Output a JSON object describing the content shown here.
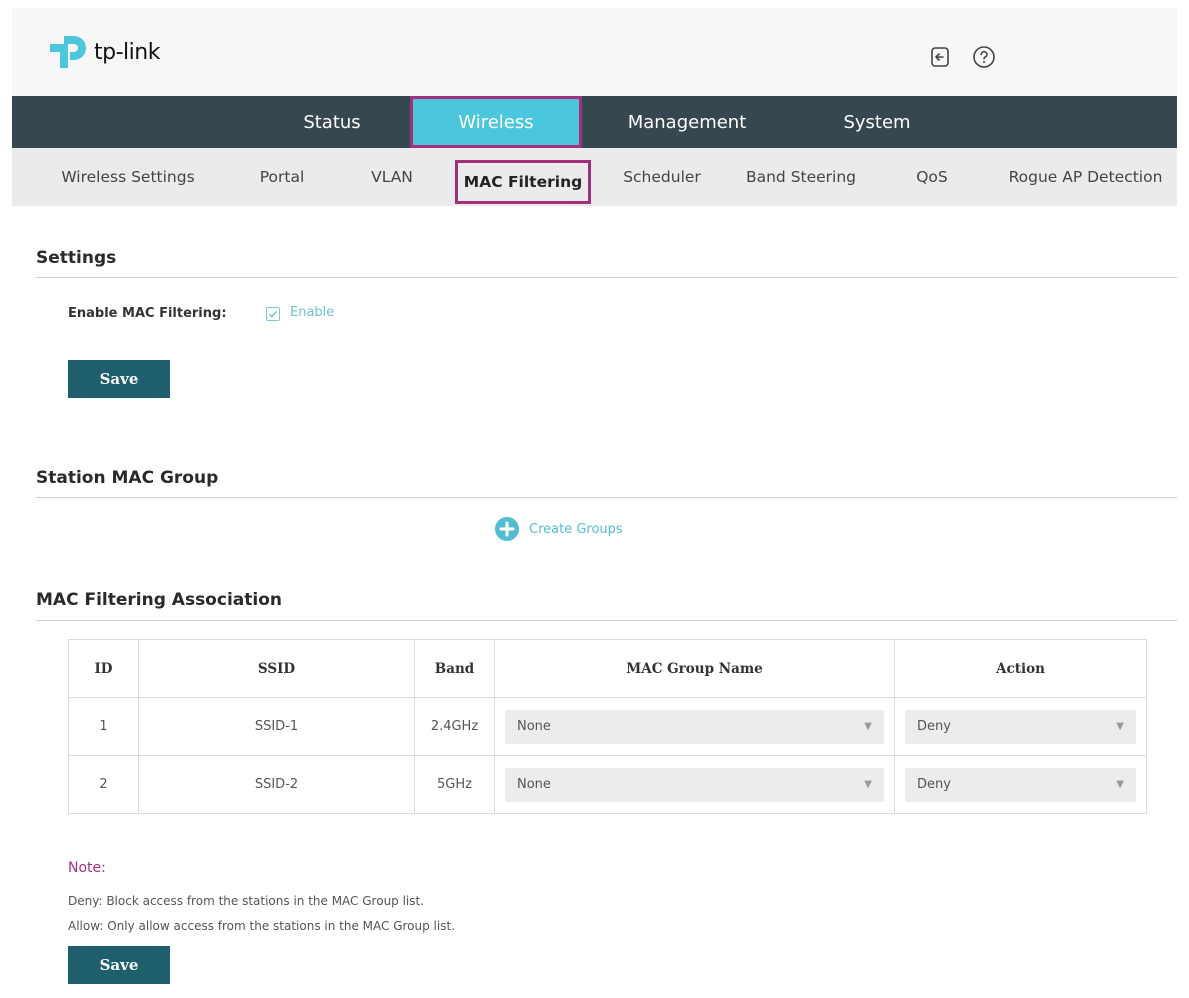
{
  "header": {
    "logo_text": "tp-link",
    "icons": [
      "logout-icon",
      "help-icon"
    ]
  },
  "main_nav": {
    "tabs": [
      {
        "label": "Status"
      },
      {
        "label": "Wireless",
        "active": true
      },
      {
        "label": "Management"
      },
      {
        "label": "System"
      }
    ]
  },
  "sub_nav": {
    "items": [
      {
        "label": "Wireless Settings"
      },
      {
        "label": "Portal"
      },
      {
        "label": "VLAN"
      },
      {
        "label": "MAC Filtering",
        "active": true
      },
      {
        "label": "Scheduler"
      },
      {
        "label": "Band Steering"
      },
      {
        "label": "QoS"
      },
      {
        "label": "Rogue AP Detection"
      }
    ]
  },
  "settings": {
    "title": "Settings",
    "field_label": "Enable MAC Filtering:",
    "checkbox_label": "Enable",
    "checked": true,
    "save_label": "Save"
  },
  "station_group": {
    "title": "Station MAC Group",
    "create_label": "Create Groups"
  },
  "association": {
    "title": "MAC Filtering Association",
    "columns": [
      "ID",
      "SSID",
      "Band",
      "MAC Group Name",
      "Action"
    ],
    "rows": [
      {
        "id": "1",
        "ssid": "SSID-1",
        "band": "2.4GHz",
        "group": "None",
        "action": "Deny"
      },
      {
        "id": "2",
        "ssid": "SSID-2",
        "band": "5GHz",
        "group": "None",
        "action": "Deny"
      }
    ]
  },
  "note": {
    "title": "Note:",
    "lines": [
      "Deny: Block access from the stations in the MAC Group list.",
      "Allow: Only allow access from the stations in the MAC Group list."
    ],
    "save_label": "Save"
  },
  "colors": {
    "nav_bg": "#37474f",
    "accent": "#4cc6dd",
    "highlight": "#a3307d",
    "button": "#1f5f6d"
  }
}
